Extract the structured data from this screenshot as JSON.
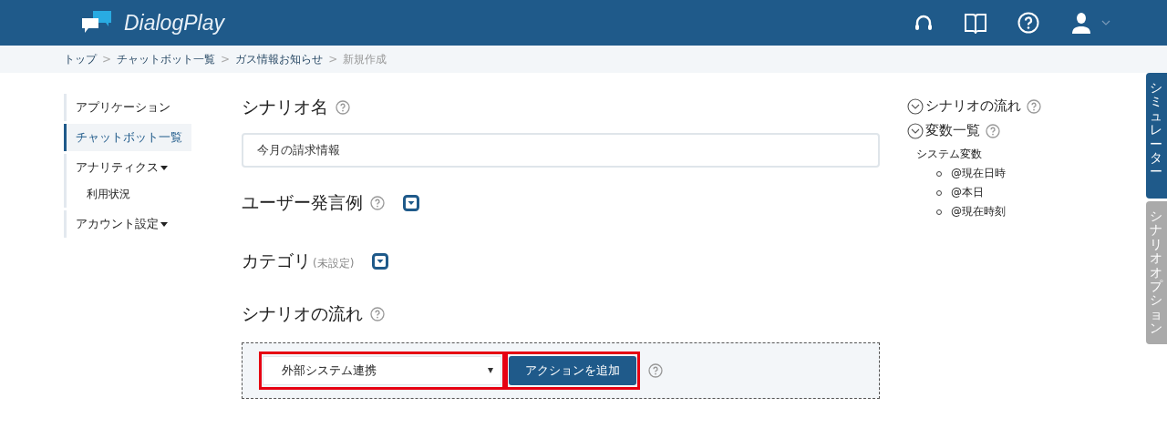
{
  "header": {
    "logo": "DialogPlay"
  },
  "breadcrumb": [
    {
      "label": "トップ",
      "current": false,
      "separator": ">"
    },
    {
      "label": "チャットボット一覧",
      "current": false,
      "separator": ">"
    },
    {
      "label": "ガス情報お知らせ",
      "current": false,
      "separator": ">"
    },
    {
      "label": "新規作成",
      "current": true
    }
  ],
  "sidebar": {
    "items": [
      {
        "label": "アプリケーション",
        "selected": false
      },
      {
        "label": "チャットボット一覧",
        "selected": true
      },
      {
        "label": "アナリティクス",
        "selected": false,
        "has_menu": true,
        "children": [
          {
            "label": "利用状況",
            "selected": false
          }
        ]
      },
      {
        "label": "アカウント設定",
        "selected": false,
        "has_menu": true
      }
    ]
  },
  "form": {
    "scenario_name": {
      "label": "シナリオ名",
      "value": "今月の請求情報"
    },
    "user_examples": {
      "label": "ユーザー発言例"
    },
    "category": {
      "label": "カテゴリ",
      "note": "(未設定)"
    },
    "flow": {
      "label": "シナリオの流れ",
      "select": {
        "value": "外部システム連携",
        "highlighted": true
      },
      "add_button": {
        "label": "アクションを追加",
        "highlighted": true
      }
    }
  },
  "right_panel": {
    "sections": [
      {
        "title": "シナリオの流れ"
      },
      {
        "title": "変数一覧",
        "groups": [
          {
            "title": "システム変数",
            "items": [
              "@現在日時",
              "@本日",
              "@現在時刻"
            ]
          }
        ]
      }
    ]
  },
  "side_tabs": [
    {
      "label": "シミュレーター",
      "selected": true
    },
    {
      "label": "シナリオオプション",
      "selected": false
    }
  ]
}
